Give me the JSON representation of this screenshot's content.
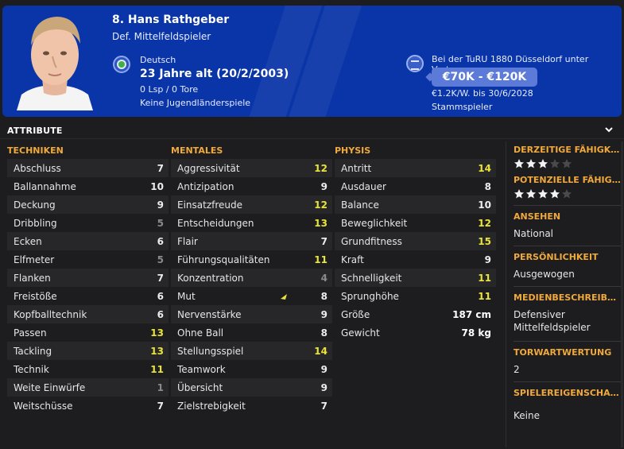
{
  "player": {
    "name": "8. Hans Rathgeber",
    "position": "Def. Mittelfeldspieler",
    "nationality": "Deutsch",
    "age": "23 Jahre alt (20/2/2003)",
    "apps": "0 Lsp / 0 Tore",
    "international": "Keine Jugendländerspiele",
    "contract": "Bei der TuRU 1880 Düsseldorf unter Vertrag",
    "value": "€70K - €120K",
    "wage": "€1.2K/W. bis 30/6/2028",
    "role": "Stammspieler"
  },
  "section": {
    "title": "ATTRIBUTE"
  },
  "columns": {
    "technical": {
      "title": "TECHNIKEN",
      "items": [
        {
          "name": "Abschluss",
          "value": "7"
        },
        {
          "name": "Ballannahme",
          "value": "10"
        },
        {
          "name": "Deckung",
          "value": "9"
        },
        {
          "name": "Dribbling",
          "value": "5"
        },
        {
          "name": "Ecken",
          "value": "6"
        },
        {
          "name": "Elfmeter",
          "value": "5"
        },
        {
          "name": "Flanken",
          "value": "7"
        },
        {
          "name": "Freistöße",
          "value": "6"
        },
        {
          "name": "Kopfballtechnik",
          "value": "6"
        },
        {
          "name": "Passen",
          "value": "13"
        },
        {
          "name": "Tackling",
          "value": "13"
        },
        {
          "name": "Technik",
          "value": "11"
        },
        {
          "name": "Weite Einwürfe",
          "value": "1"
        },
        {
          "name": "Weitschüsse",
          "value": "7"
        }
      ]
    },
    "mental": {
      "title": "MENTALES",
      "items": [
        {
          "name": "Aggressivität",
          "value": "12"
        },
        {
          "name": "Antizipation",
          "value": "9"
        },
        {
          "name": "Einsatzfreude",
          "value": "12"
        },
        {
          "name": "Entscheidungen",
          "value": "13"
        },
        {
          "name": "Flair",
          "value": "7"
        },
        {
          "name": "Führungsqualitäten",
          "value": "11"
        },
        {
          "name": "Konzentration",
          "value": "4"
        },
        {
          "name": "Mut",
          "value": "8"
        },
        {
          "name": "Nervenstärke",
          "value": "9"
        },
        {
          "name": "Ohne Ball",
          "value": "8"
        },
        {
          "name": "Stellungsspiel",
          "value": "14"
        },
        {
          "name": "Teamwork",
          "value": "9"
        },
        {
          "name": "Übersicht",
          "value": "9"
        },
        {
          "name": "Zielstrebigkeit",
          "value": "7"
        }
      ]
    },
    "physical": {
      "title": "PHYSIS",
      "items": [
        {
          "name": "Antritt",
          "value": "14"
        },
        {
          "name": "Ausdauer",
          "value": "8"
        },
        {
          "name": "Balance",
          "value": "10"
        },
        {
          "name": "Beweglichkeit",
          "value": "12"
        },
        {
          "name": "Grundfitness",
          "value": "15"
        },
        {
          "name": "Kraft",
          "value": "9"
        },
        {
          "name": "Schnelligkeit",
          "value": "11"
        },
        {
          "name": "Sprunghöhe",
          "value": "11"
        }
      ],
      "extra": [
        {
          "name": "Größe",
          "value": "187 cm"
        },
        {
          "name": "Gewicht",
          "value": "78 kg"
        }
      ]
    }
  },
  "side": {
    "current_ability_label": "DERZEITIGE FÄHIGKEIT",
    "current_ability_stars": 3,
    "potential_ability_label": "POTENZIELLE FÄHIGKEIT",
    "potential_ability_stars": 4,
    "star_total": 5,
    "reputation_label": "ANSEHEN",
    "reputation": "National",
    "personality_label": "PERSÖNLICHKEIT",
    "personality": "Ausgewogen",
    "media_label": "MEDIENBESCHREIBUNG",
    "media_line1": "Defensiver",
    "media_line2": "Mittelfeldspieler",
    "gk_label": "TORWARTWERTUNG",
    "gk": "2",
    "traits_label": "SPIELEREIGENSCHAFTEN",
    "traits": "Keine"
  },
  "colors": {
    "header_bg": "#0a35a8",
    "accent_orange": "#f0a93a",
    "value_yellow": "#e8e43a",
    "value_grey": "#8a8a8a"
  }
}
